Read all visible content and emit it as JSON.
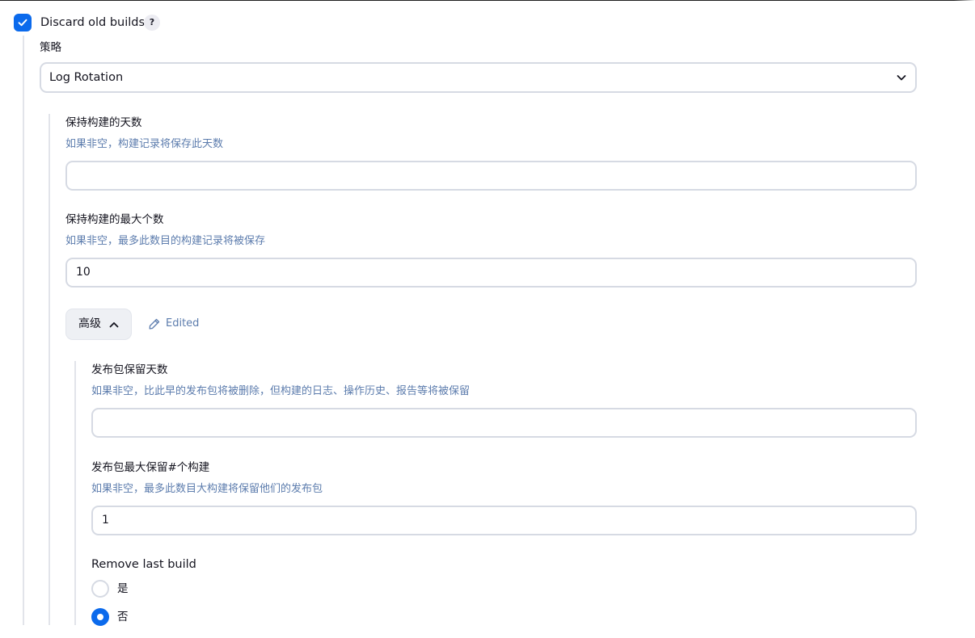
{
  "discard": {
    "label": "Discard old builds",
    "checked": true,
    "help": "?"
  },
  "strategy": {
    "label": "策略",
    "selected": "Log Rotation"
  },
  "days_to_keep": {
    "label": "保持构建的天数",
    "description": "如果非空，构建记录将保存此天数",
    "value": ""
  },
  "num_to_keep": {
    "label": "保持构建的最大个数",
    "description": "如果非空，最多此数目的构建记录将被保存",
    "value": "10"
  },
  "advanced": {
    "label": "高级",
    "edited_label": "Edited"
  },
  "artifact_days": {
    "label": "发布包保留天数",
    "description": "如果非空，比此早的发布包将被删除，但构建的日志、操作历史、报告等将被保留",
    "value": ""
  },
  "artifact_num": {
    "label": "发布包最大保留#个构建",
    "description": "如果非空，最多此数目大构建将保留他们的发布包",
    "value": "1"
  },
  "remove_last_build": {
    "label": "Remove last build",
    "options": [
      {
        "label": "是",
        "selected": false
      },
      {
        "label": "否",
        "selected": true
      }
    ]
  },
  "colors": {
    "accent": "#0b6aec",
    "description_text": "#5c7cad",
    "border": "#d6dae3"
  }
}
